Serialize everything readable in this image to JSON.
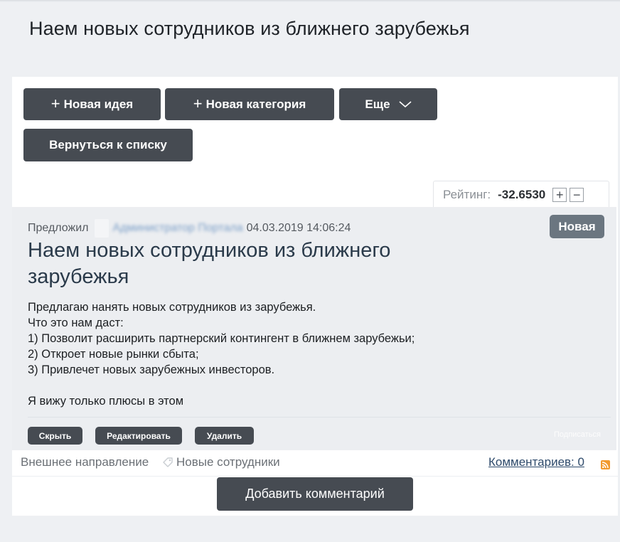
{
  "page": {
    "title": "Наем новых сотрудников из ближнего зарубежья"
  },
  "toolbar": {
    "new_idea_label": "Новая идея",
    "new_category_label": "Новая категория",
    "more_label": "Еще",
    "back_label": "Вернуться к списку"
  },
  "rating": {
    "label": "Рейтинг:",
    "value": "-32.6530",
    "plus": "+",
    "minus": "−"
  },
  "idea": {
    "proposed_by_label": "Предложил",
    "author": "Администратор Портала",
    "datetime": "04.03.2019 14:06:24",
    "status": "Новая",
    "title": "Наем новых сотрудников из ближнего зарубежья",
    "body": [
      "Предлагаю нанять новых сотрудников из зарубежья.",
      "Что это нам даст:",
      "1) Позволит расширить партнерский контингент в ближнем зарубежьи;",
      "2) Откроет новые рынки сбыта;",
      "3) Привлечет новых зарубежных инвесторов.",
      "",
      "Я вижу только плюсы в этом"
    ],
    "actions": {
      "hide": "Скрыть",
      "edit": "Редактировать",
      "delete": "Удалить",
      "subscribe": "Подписаться"
    }
  },
  "footer": {
    "category": "Внешнее направление",
    "tag": "Новые сотрудники",
    "comments": "Комментариев: 0",
    "add_comment": "Добавить комментарий"
  },
  "colors": {
    "button_bg": "#464b52",
    "status_badge": "#6b7680",
    "card_bg": "#eceef1",
    "link": "#2e4a6b",
    "rss": "#f29a2e"
  }
}
